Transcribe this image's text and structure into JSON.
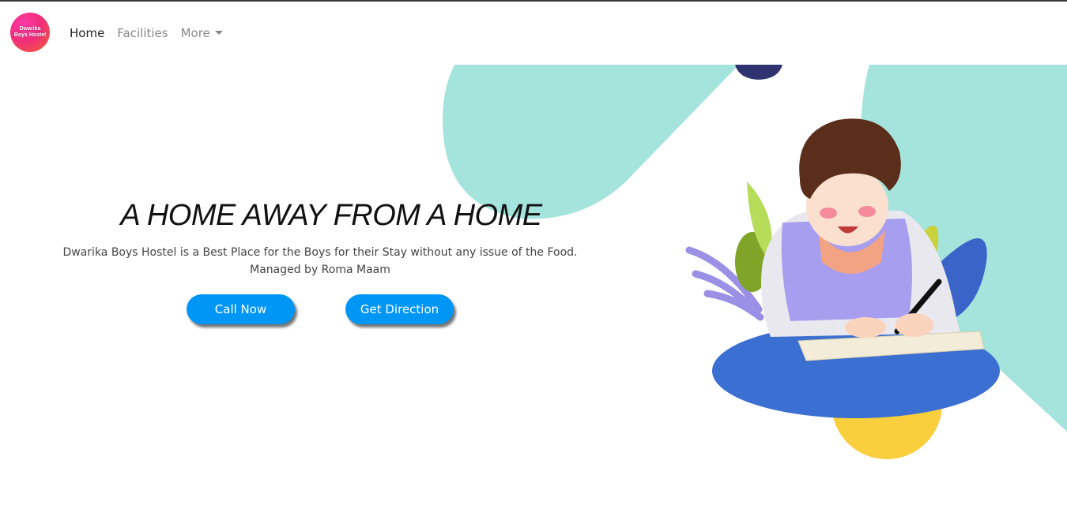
{
  "brand": {
    "logo_line1": "Dwarika",
    "logo_line2": "Boys Hostel"
  },
  "nav": {
    "items": [
      {
        "label": "Home",
        "active": true
      },
      {
        "label": "Facilities",
        "active": false
      },
      {
        "label": "More",
        "dropdown": true
      }
    ]
  },
  "hero": {
    "title": "A HOME AWAY FROM A HOME",
    "description_line1": "Dwarika Boys Hostel is a Best Place for the Boys for their Stay without any issue of the Food.",
    "description_line2": "Managed by Roma Maam"
  },
  "buttons": {
    "call_label": "Call Now",
    "direction_label": "Get Direction"
  },
  "colors": {
    "accent": "#0096f5",
    "mint": "#a5e4dc",
    "navy": "#2f3470",
    "cushion": "#3b6fd1",
    "yellow": "#f9cf3d",
    "vest": "#a79ef0"
  },
  "illustration": {
    "subject": "boy-writing-in-notebook-illustration"
  }
}
